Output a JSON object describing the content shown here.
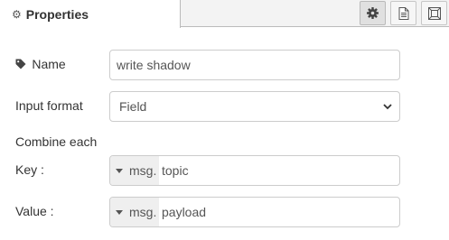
{
  "tabs": {
    "properties_label": "Properties",
    "properties_icon": "gear-icon",
    "buttons": [
      "gear-icon",
      "document-icon",
      "frame-icon"
    ]
  },
  "form": {
    "name": {
      "label": "Name",
      "icon": "tag-icon",
      "value": "write shadow"
    },
    "input_format": {
      "label": "Input format",
      "selected": "Field"
    },
    "combine_label": "Combine each",
    "key": {
      "label": "Key :",
      "type_prefix": "msg.",
      "value": "topic"
    },
    "value": {
      "label": "Value :",
      "type_prefix": "msg.",
      "value": "payload"
    }
  }
}
